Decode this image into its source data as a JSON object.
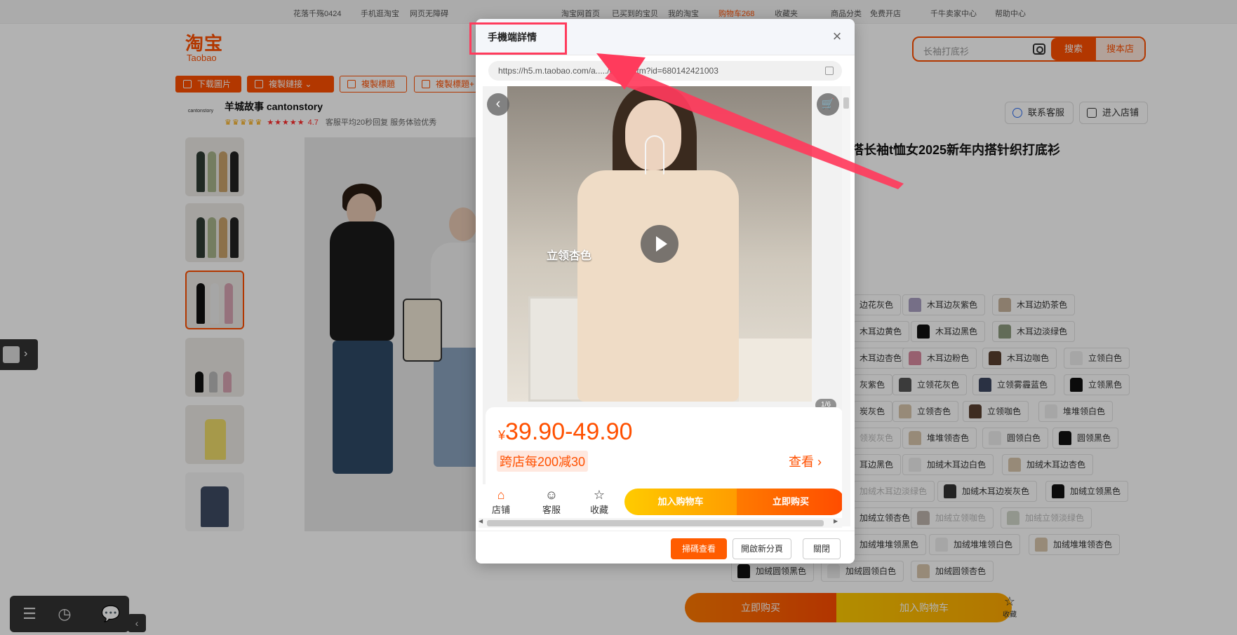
{
  "topbar": {
    "items": [
      "花落千殇0424",
      "手机逛淘宝",
      "网页无障碍",
      "淘宝网首页",
      "已买到的宝贝",
      "我的淘宝",
      "购物车268",
      "收藏夹",
      "商品分类",
      "免费开店",
      "千牛卖家中心",
      "帮助中心"
    ]
  },
  "logo": {
    "cn": "淘宝",
    "en": "Taobao"
  },
  "search": {
    "placeholder": "长袖打底衫",
    "search_label": "搜索",
    "search_shop_label": "搜本店"
  },
  "toolbar": {
    "download": "下载圖片",
    "copy_link": "複製鏈接",
    "copy_title": "複製標題",
    "copy_title2": "複製標題+"
  },
  "shop": {
    "logo_text": "cantonstory",
    "name": "羊城故事 cantonstory",
    "rating": "4.7",
    "meta": "客服平均20秒回复  服务体验优秀"
  },
  "header_buttons": {
    "contact": "联系客服",
    "enter_shop": "进入店铺"
  },
  "product": {
    "title": "搭长袖t恤女2025新年内搭针织打底衫"
  },
  "colors": [
    "边花灰色",
    "木耳边灰紫色",
    "木耳边奶茶色",
    "木耳边黄色",
    "木耳边黑色",
    "木耳边淡绿色",
    "木耳边杏色",
    "木耳边粉色",
    "木耳边咖色",
    "立领白色",
    "灰紫色",
    "立领花灰色",
    "立领雾霾蓝色",
    "立领黑色",
    "炭灰色",
    "立领杏色",
    "立领咖色",
    "堆堆领白色",
    "领炭灰色",
    "堆堆领杏色",
    "圆领白色",
    "圆领黑色",
    "耳边黑色",
    "加绒木耳边白色",
    "加绒木耳边杏色",
    "加绒木耳边淡绿色",
    "加绒木耳边炭灰色",
    "加绒立领黑色",
    "加绒立领杏色",
    "加绒立领咖色",
    "加绒立领淡绿色",
    "加绒堆堆领黑色",
    "加绒堆堆领白色",
    "加绒堆堆领杏色",
    "加绒圆领黑色",
    "加绒圆领白色",
    "加绒圆领杏色"
  ],
  "bottom_bar": {
    "buy_now": "立即购买",
    "add_cart": "加入购物车",
    "favorite": "收藏"
  },
  "modal": {
    "title": "手機端詳情",
    "url": "https://h5.m.taobao.com/a...../detail.htm?id=680142421003",
    "video_label": "立领杏色",
    "pager": "1/6",
    "price_yen": "¥",
    "price": "39.90-49.90",
    "promo": "跨店每200减30",
    "view_more": "查看",
    "actions": {
      "shop": "店铺",
      "service": "客服",
      "favorite": "收藏",
      "add_cart": "加入购物车",
      "buy_now": "立即购买"
    },
    "footer": {
      "scan": "掃碼查看",
      "new_tab": "開啟新分頁",
      "close": "關閉"
    }
  },
  "accent_color": "#ff5000",
  "annotation_color": "#ff3b5c"
}
